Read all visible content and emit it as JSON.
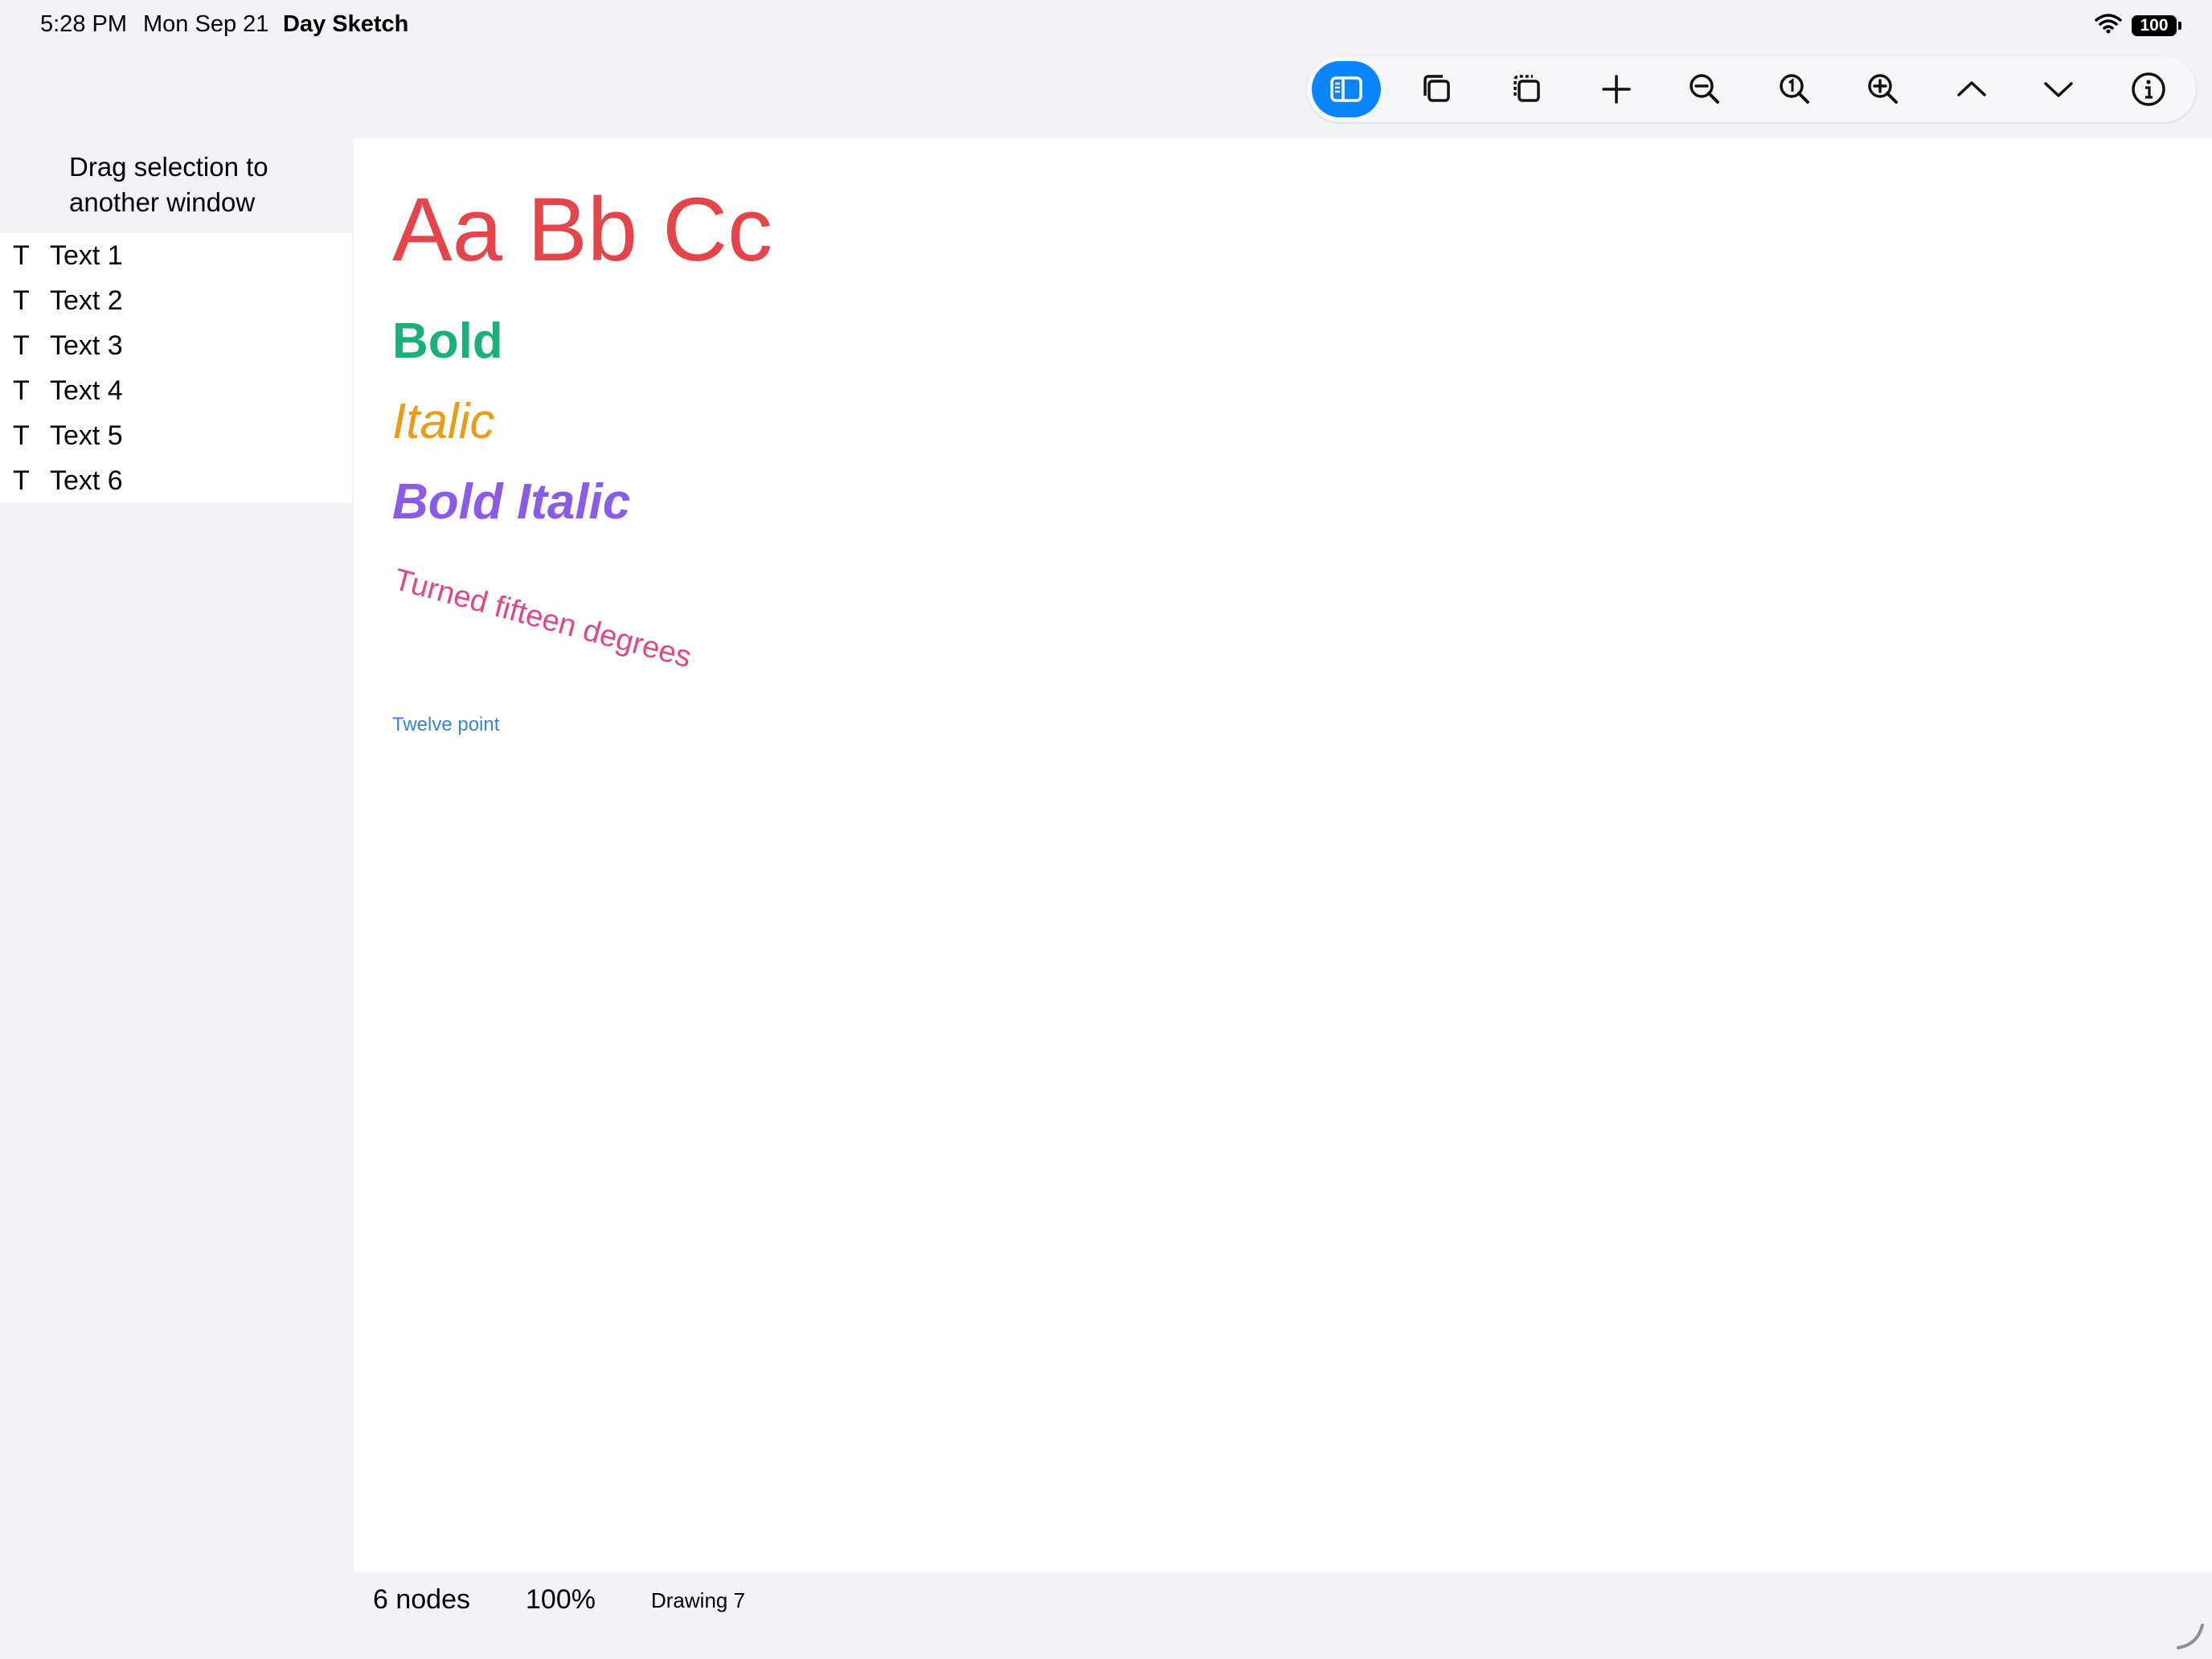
{
  "status_bar": {
    "time": "5:28 PM",
    "date": "Mon Sep 21",
    "app_name": "Day Sketch",
    "battery": "100"
  },
  "toolbar": {
    "buttons": [
      {
        "name": "toggle-sidebar",
        "icon": "sidebar-icon",
        "active": true
      },
      {
        "name": "duplicate",
        "icon": "duplicate-icon"
      },
      {
        "name": "duplicate-selection",
        "icon": "dashed-duplicate-icon"
      },
      {
        "name": "add",
        "icon": "plus-icon"
      },
      {
        "name": "zoom-out",
        "icon": "zoom-out-icon"
      },
      {
        "name": "actual-size",
        "icon": "zoom-actual-size-icon"
      },
      {
        "name": "zoom-in",
        "icon": "zoom-in-icon"
      },
      {
        "name": "move-up",
        "icon": "chevron-up-icon"
      },
      {
        "name": "move-down",
        "icon": "chevron-down-icon"
      },
      {
        "name": "info",
        "icon": "info-icon"
      }
    ],
    "accent": "#0a84ff"
  },
  "sidebar": {
    "hint": "Drag selection to another window",
    "items": [
      {
        "icon": "T",
        "label": "Text 1"
      },
      {
        "icon": "T",
        "label": "Text 2"
      },
      {
        "icon": "T",
        "label": "Text 3"
      },
      {
        "icon": "T",
        "label": "Text 4"
      },
      {
        "icon": "T",
        "label": "Text 5"
      },
      {
        "icon": "T",
        "label": "Text 6"
      }
    ]
  },
  "canvas": {
    "texts": [
      {
        "text": "Aa Bb Cc",
        "color": "#e4454b"
      },
      {
        "text": "Bold",
        "color": "#1bb07a"
      },
      {
        "text": "Italic",
        "color": "#eb9b14"
      },
      {
        "text": "Bold Italic",
        "color": "#8a5ce6"
      },
      {
        "text": "Turned fifteen degrees",
        "color": "#e04787"
      },
      {
        "text": "Twelve point",
        "color": "#3b82d6"
      }
    ]
  },
  "bottom_bar": {
    "node_count": "6 nodes",
    "zoom": "100%",
    "document_name": "Drawing 7"
  }
}
